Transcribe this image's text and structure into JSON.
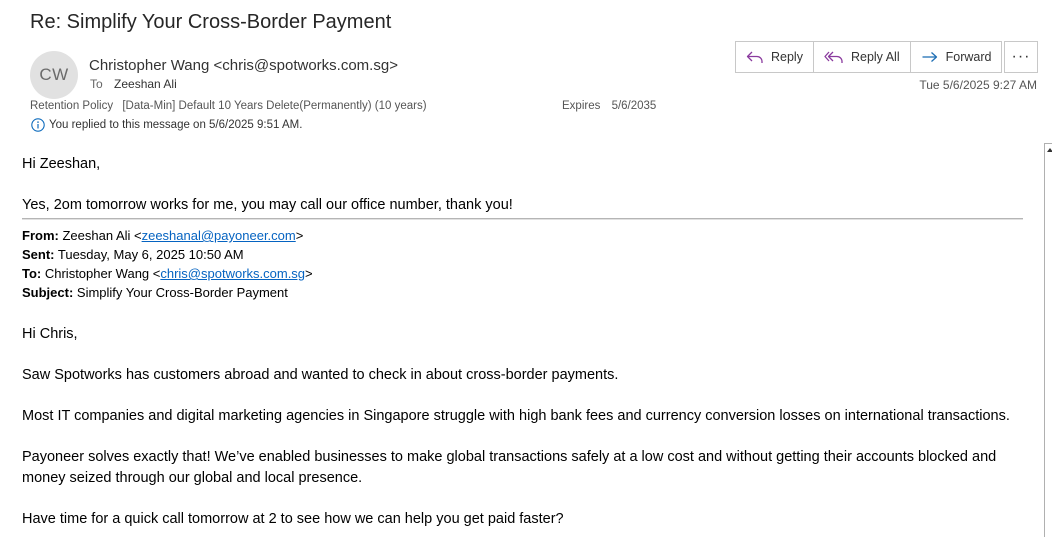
{
  "email": {
    "subject": "Re: Simplify Your Cross-Border Payment",
    "avatar_initials": "CW",
    "sender": "Christopher Wang <chris@spotworks.com.sg>",
    "to_label": "To",
    "to_value": "Zeeshan Ali",
    "retention_label": "Retention Policy",
    "retention_value": "[Data-Min] Default 10 Years Delete(Permanently) (10 years)",
    "expires_label": "Expires",
    "expires_value": "5/6/2035",
    "replied_notice": "You replied to this message on 5/6/2025 9:51 AM.",
    "datetime": "Tue 5/6/2025 9:27 AM"
  },
  "actions": {
    "reply": "Reply",
    "reply_all": "Reply All",
    "forward": "Forward",
    "more": "···"
  },
  "body": {
    "greeting": "Hi Zeeshan,",
    "reply_text": "Yes, 2om tomorrow works for me, you may call our office number, thank you!",
    "quoted_header": {
      "from_label": "From:",
      "from_name": " Zeeshan Ali <",
      "from_email": "zeeshanal@payoneer.com",
      "from_end": ">",
      "sent_label": "Sent:",
      "sent_value": " Tuesday, May 6, 2025 10:50 AM",
      "to_label": "To:",
      "to_name": " Christopher Wang <",
      "to_email": "chris@spotworks.com.sg",
      "to_end": ">",
      "subject_label": "Subject:",
      "subject_value": " Simplify Your Cross-Border Payment"
    },
    "quoted_greeting": "Hi Chris,",
    "para1": "Saw Spotworks has customers abroad and wanted to check in about cross-border payments.",
    "para2": "Most IT companies and digital marketing agencies in Singapore struggle with high bank fees and currency conversion losses on international transactions.",
    "para3": "Payoneer solves exactly that! We’ve enabled businesses to make global transactions safely at a low cost and without getting their accounts blocked and money seized through our global and local presence.",
    "para4": "Have time for a quick call tomorrow at 2 to see how we can help you get paid faster?"
  }
}
